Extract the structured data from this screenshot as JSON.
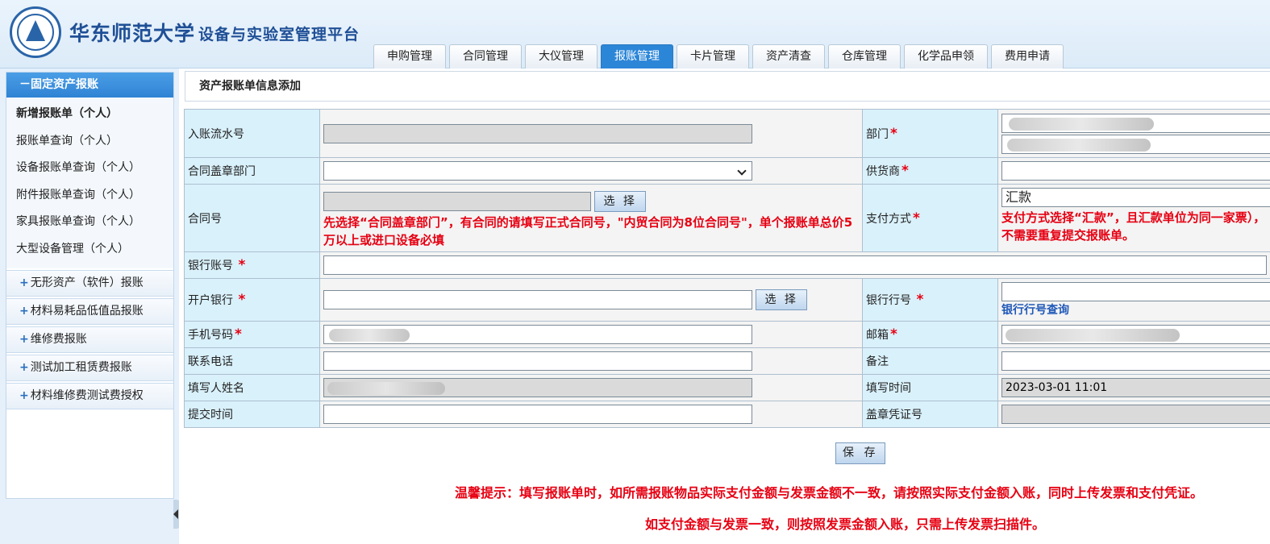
{
  "header": {
    "university": "华东师范大学",
    "platform": "设备与实验室管理平台",
    "tabs": [
      {
        "label": "申购管理",
        "active": false
      },
      {
        "label": "合同管理",
        "active": false
      },
      {
        "label": "大仪管理",
        "active": false
      },
      {
        "label": "报账管理",
        "active": true
      },
      {
        "label": "卡片管理",
        "active": false
      },
      {
        "label": "资产清查",
        "active": false
      },
      {
        "label": "仓库管理",
        "active": false
      },
      {
        "label": "化学品申领",
        "active": false
      },
      {
        "label": "费用申请",
        "active": false
      }
    ]
  },
  "sidebar": {
    "open_group": "固定资产报账",
    "open_group_icon": "minus",
    "items": [
      {
        "label": "新增报账单（个人）",
        "selected": true
      },
      {
        "label": "报账单查询（个人）"
      },
      {
        "label": "设备报账单查询（个人）"
      },
      {
        "label": "附件报账单查询（个人）"
      },
      {
        "label": "家具报账单查询（个人）"
      },
      {
        "label": "大型设备管理（个人）"
      }
    ],
    "groups": [
      {
        "label": "无形资产（软件）报账",
        "icon": "plus"
      },
      {
        "label": "材料易耗品低值品报账",
        "icon": "plus"
      },
      {
        "label": "维修费报账",
        "icon": "plus"
      },
      {
        "label": "测试加工租赁费报账",
        "icon": "plus"
      },
      {
        "label": "材料维修费测试费授权",
        "icon": "plus"
      }
    ]
  },
  "main": {
    "panel_title": "资产报账单信息添加",
    "fields": {
      "entry_no": {
        "label": "入账流水号",
        "value": ""
      },
      "department": {
        "label": "部门",
        "required": true
      },
      "contract_dept": {
        "label": "合同盖章部门",
        "value": ""
      },
      "supplier": {
        "label": "供货商",
        "required": true,
        "value": ""
      },
      "contract_no": {
        "label": "合同号",
        "value": "",
        "button": "选 择",
        "hint": "先选择“合同盖章部门”，有合同的请填写正式合同号，\"内贸合同为8位合同号\"，单个报账单总价5万以上或进口设备必填"
      },
      "payment": {
        "label": "支付方式",
        "required": true,
        "value": "汇款",
        "hint": "支付方式选择“汇款”，且汇款单位为同一家票），不需要重复提交报账单。"
      },
      "bank_account": {
        "label": "银行账号",
        "required": true,
        "value": ""
      },
      "bank": {
        "label": "开户银行",
        "required": true,
        "value": "",
        "button": "选 择"
      },
      "bank_code": {
        "label": "银行行号",
        "required": true,
        "value": "",
        "link": "银行行号查询"
      },
      "mobile": {
        "label": "手机号码",
        "required": true
      },
      "email": {
        "label": "邮箱",
        "required": true
      },
      "phone": {
        "label": "联系电话",
        "value": ""
      },
      "remark": {
        "label": "备注",
        "value": ""
      },
      "filler_name": {
        "label": "填写人姓名"
      },
      "fill_time": {
        "label": "填写时间",
        "value": "2023-03-01 11:01"
      },
      "submit_time": {
        "label": "提交时间",
        "value": ""
      },
      "seal_voucher": {
        "label": "盖章凭证号",
        "value": ""
      }
    },
    "save_label": "保 存",
    "tip1": "温馨提示：填写报账单时，如所需报账物品实际支付金额与发票金额不一致，请按照实际支付金额入账，同时上传发票和支付凭证。",
    "tip2": "如支付金额与发票一致，则按照发票金额入账，只需上传发票扫描件。"
  }
}
